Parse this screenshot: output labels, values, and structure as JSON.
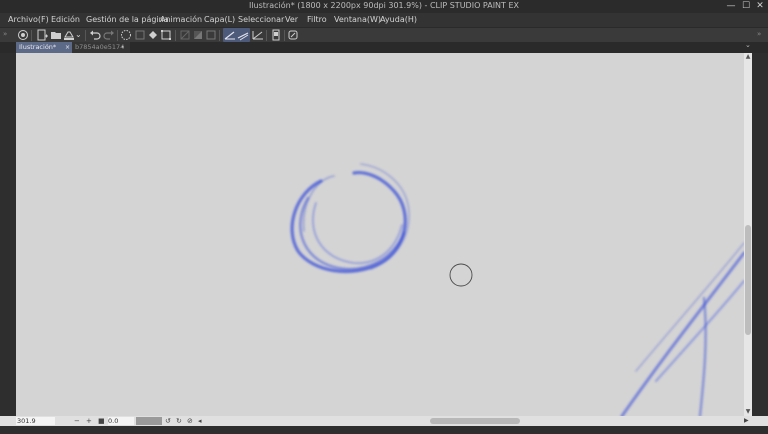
{
  "window": {
    "title": "Ilustración* (1800 x 2200px 90dpi 301.9%) - CLIP STUDIO PAINT EX",
    "minimize_glyph": "—",
    "maximize_glyph": "☐",
    "close_glyph": "✕"
  },
  "menu": {
    "items": [
      {
        "label": "Archivo(F)"
      },
      {
        "label": "Edición"
      },
      {
        "label": "Gestión de la página"
      },
      {
        "label": "Animación"
      },
      {
        "label": "Capa(L)"
      },
      {
        "label": "Seleccionar"
      },
      {
        "label": "Ver"
      },
      {
        "label": "Filtro"
      },
      {
        "label": "Ventana(W)"
      },
      {
        "label": "Ayuda(H)"
      }
    ]
  },
  "toolbar": {
    "icons": [
      "clip-studio-icon",
      "new-file-icon",
      "open-file-icon",
      "save-icon",
      "save-dropdown-icon",
      "undo-icon",
      "redo-icon",
      "loading-icon",
      "clear-icon",
      "fill-icon",
      "transform-icon",
      "hide-outside-icon",
      "crop-icon",
      "border-icon",
      "snap-ruler-icon",
      "snap-special-ruler-icon",
      "snap-grid-icon",
      "tablet-icon",
      "settings-icon"
    ],
    "left_arrows": "»",
    "right_arrows": "»",
    "tab_menu_chevron": "⌄"
  },
  "tabs": [
    {
      "label": "Ilustración*",
      "close": "×",
      "active": true
    },
    {
      "label": "b7854a0e5174",
      "close": "•",
      "active": false
    }
  ],
  "status": {
    "zoom_value": "301.9",
    "zoom_minus": "−",
    "zoom_plus": "+",
    "angle_value": "0.0",
    "rotate_left": "↺",
    "rotate_right": "↻",
    "reset_rotation": "⊘",
    "flip": "◂"
  },
  "canvas": {
    "background": "#d4d4d4",
    "stroke_color": "#3a4fd8"
  }
}
